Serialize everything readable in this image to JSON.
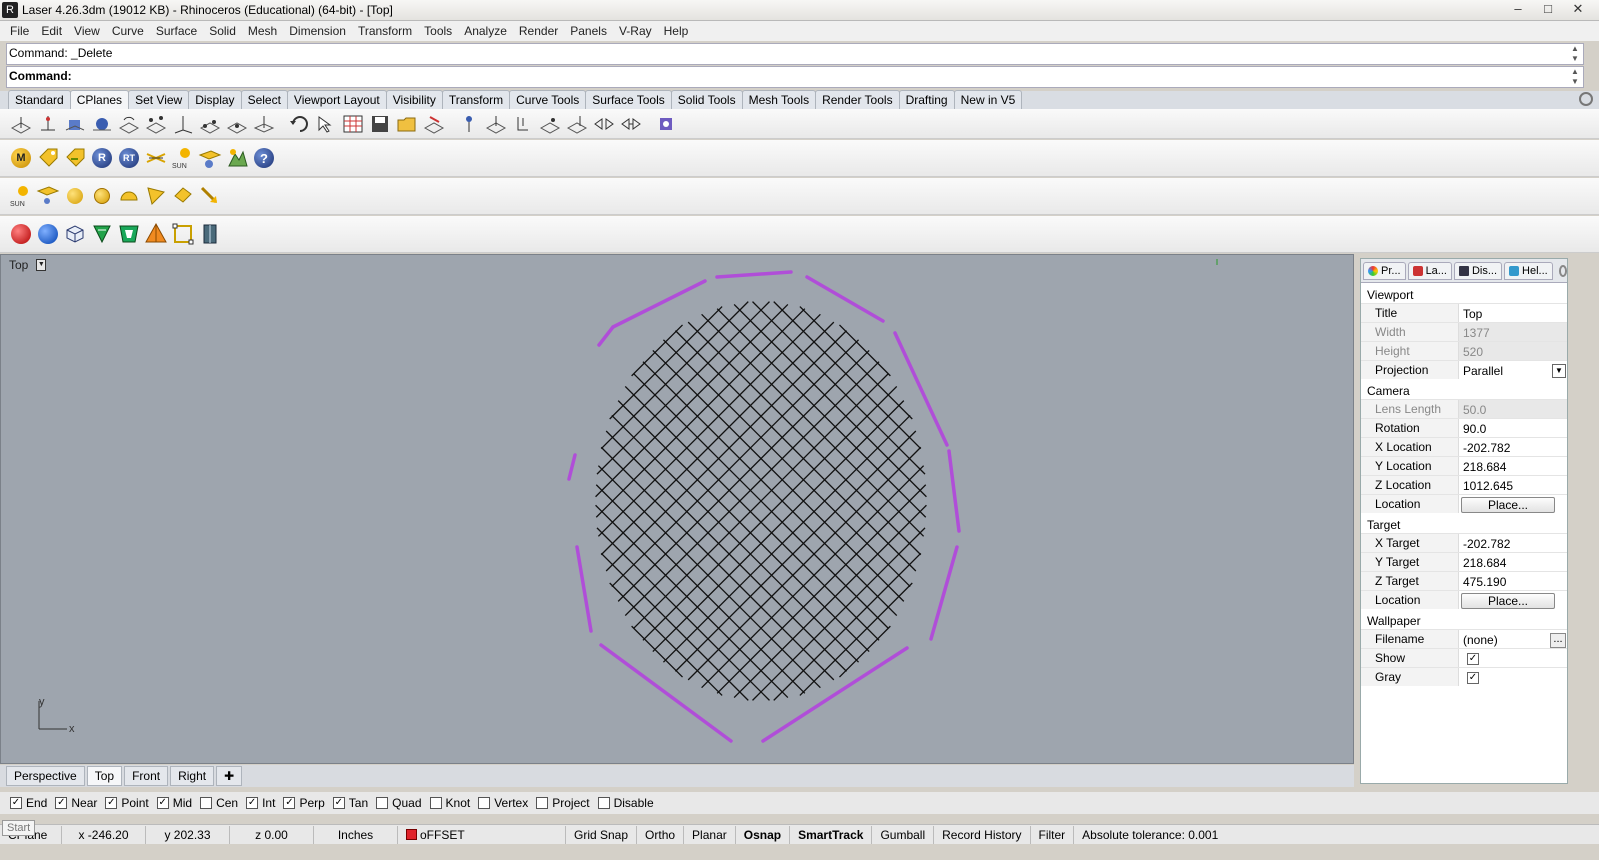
{
  "window": {
    "title": "Laser 4.26.3dm (19012 KB) - Rhinoceros (Educational) (64-bit) - [Top]"
  },
  "menu": [
    "File",
    "Edit",
    "View",
    "Curve",
    "Surface",
    "Solid",
    "Mesh",
    "Dimension",
    "Transform",
    "Tools",
    "Analyze",
    "Render",
    "Panels",
    "V-Ray",
    "Help"
  ],
  "command": {
    "history": "Command: _Delete",
    "prompt": "Command:"
  },
  "toolbar_tabs": [
    "Standard",
    "CPlanes",
    "Set View",
    "Display",
    "Select",
    "Viewport Layout",
    "Visibility",
    "Transform",
    "Curve Tools",
    "Surface Tools",
    "Solid Tools",
    "Mesh Tools",
    "Render Tools",
    "Drafting",
    "New in V5"
  ],
  "active_toolbar_tab": "CPlanes",
  "vray_toolbar": [
    "M",
    "RT"
  ],
  "viewport": {
    "title": "Top",
    "axis_x": "x",
    "axis_y": "y"
  },
  "viewport_tabs": [
    "Perspective",
    "Top",
    "Front",
    "Right"
  ],
  "active_viewport_tab": "Top",
  "osnap": [
    {
      "label": "End",
      "checked": true
    },
    {
      "label": "Near",
      "checked": true
    },
    {
      "label": "Point",
      "checked": true
    },
    {
      "label": "Mid",
      "checked": true
    },
    {
      "label": "Cen",
      "checked": false
    },
    {
      "label": "Int",
      "checked": true
    },
    {
      "label": "Perp",
      "checked": true
    },
    {
      "label": "Tan",
      "checked": true
    },
    {
      "label": "Quad",
      "checked": false
    },
    {
      "label": "Knot",
      "checked": false
    },
    {
      "label": "Vertex",
      "checked": false
    },
    {
      "label": "Project",
      "checked": false
    },
    {
      "label": "Disable",
      "checked": false
    }
  ],
  "status": {
    "cplane": "CPlane",
    "x": "x -246.20",
    "y": "y 202.33",
    "z": "z 0.00",
    "units": "Inches",
    "layer": "oFFSET",
    "layer_color": "#e0232b",
    "grid_snap": "Grid Snap",
    "ortho": "Ortho",
    "planar": "Planar",
    "osnap": "Osnap",
    "smarttrack": "SmartTrack",
    "gumball": "Gumball",
    "record_history": "Record History",
    "filter": "Filter",
    "tolerance": "Absolute tolerance: 0.001",
    "start": "Start"
  },
  "panel": {
    "tabs": [
      "Pr...",
      "La...",
      "Dis...",
      "Hel..."
    ],
    "viewport_section": "Viewport",
    "title_label": "Title",
    "title_value": "Top",
    "width_label": "Width",
    "width_value": "1377",
    "height_label": "Height",
    "height_value": "520",
    "projection_label": "Projection",
    "projection_value": "Parallel",
    "camera_section": "Camera",
    "lens_label": "Lens Length",
    "lens_value": "50.0",
    "rotation_label": "Rotation",
    "rotation_value": "90.0",
    "xloc_label": "X Location",
    "xloc_value": "-202.782",
    "yloc_label": "Y Location",
    "yloc_value": "218.684",
    "zloc_label": "Z Location",
    "zloc_value": "1012.645",
    "loc_label": "Location",
    "place_button": "Place...",
    "target_section": "Target",
    "xtgt_label": "X Target",
    "xtgt_value": "-202.782",
    "ytgt_label": "Y Target",
    "ytgt_value": "218.684",
    "ztgt_label": "Z Target",
    "ztgt_value": "475.190",
    "wallpaper_section": "Wallpaper",
    "filename_label": "Filename",
    "filename_value": "(none)",
    "show_label": "Show",
    "gray_label": "Gray",
    "browse_button": "...",
    "show_checked": true,
    "gray_checked": true
  },
  "colors": {
    "viewport_bg": "#9ea5ae",
    "offset_curve": "#b04ed8",
    "grid_lines": "#111111"
  }
}
